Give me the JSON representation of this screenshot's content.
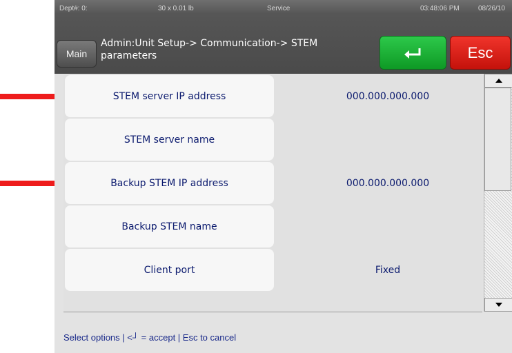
{
  "status_bar": {
    "dept": "Dept#: 0:",
    "weight": "30 x 0.01 lb",
    "mode": "Service",
    "time": "03:48:06 PM",
    "date": "08/26/10"
  },
  "header": {
    "main_label": "Main",
    "breadcrumb": "Admin:Unit Setup-> Communication-> STEM parameters",
    "enter_icon": "enter-return-icon",
    "esc_label": "Esc"
  },
  "rows": [
    {
      "label": "STEM server IP address",
      "value": "000.000.000.000"
    },
    {
      "label": "STEM server name",
      "value": ""
    },
    {
      "label": "Backup STEM IP address",
      "value": "000.000.000.000"
    },
    {
      "label": "Backup STEM name",
      "value": ""
    },
    {
      "label": "Client port",
      "value": "Fixed"
    }
  ],
  "scrollbar": {
    "up_icon": "scroll-up-icon",
    "down_icon": "scroll-down-icon"
  },
  "footer": {
    "hint": "Select options | <┘ = accept | Esc to cancel"
  },
  "colors": {
    "accent_red": "#ee1c1c",
    "enter_green": "#18b233",
    "esc_red": "#e01e16",
    "text_blue": "#0b1a6e"
  }
}
